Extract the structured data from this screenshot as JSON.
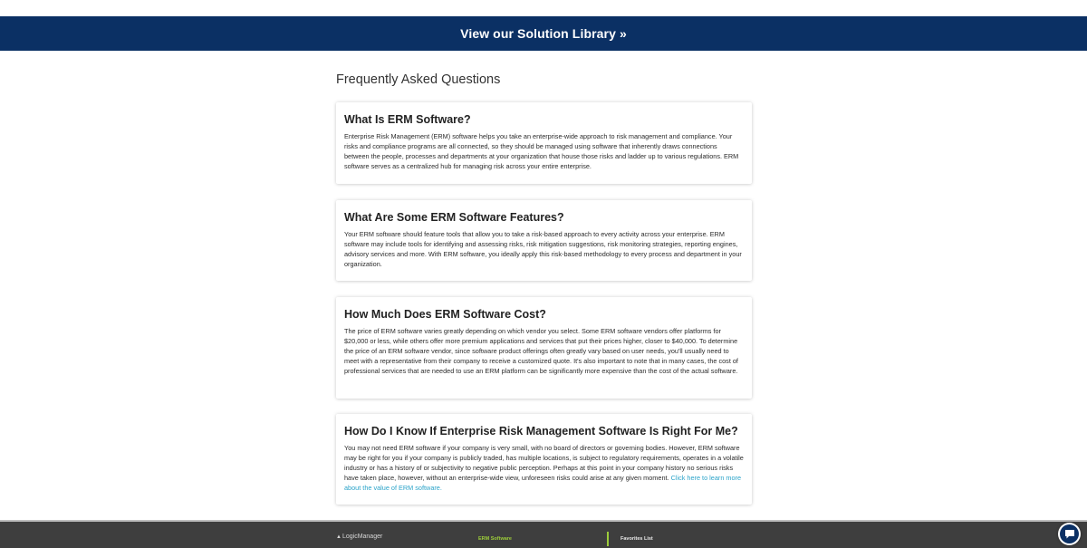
{
  "banner": {
    "link_text": "View our Solution Library »"
  },
  "faq": {
    "title": "Frequently Asked Questions",
    "items": [
      {
        "question": "What Is ERM Software?",
        "answer": "Enterprise Risk Management (ERM) software helps you take an enterprise-wide approach to risk management and compliance. Your risks and compliance programs are all connected, so they should be managed using software that inherently draws connections between the people, processes and departments at your organization that house those risks and ladder up to various regulations. ERM software serves as a centralized hub for managing risk across your entire enterprise."
      },
      {
        "question": "What Are Some ERM Software Features?",
        "answer": "Your ERM software should feature tools that allow you to take a risk-based approach to every activity across your enterprise. ERM software may include tools for identifying and assessing risks, risk mitigation suggestions, risk monitoring strategies, reporting engines, advisory services and more. With ERM software, you ideally apply this risk-based methodology to every process and department in your organization."
      },
      {
        "question": "How Much Does ERM Software Cost?",
        "answer": "The price of ERM software varies greatly depending on which vendor you select. Some ERM software vendors offer platforms for $20,000 or less, while others offer more premium applications and services that put their prices higher, closer to $40,000. To determine the price of an ERM software vendor, since software product offerings often greatly vary based on user needs, you'll usually need to meet with a representative from their company to receive a customized quote. It's also important to note that in many cases, the cost of professional services that are needed to use an ERM platform can be significantly more expensive than the cost of the actual software."
      },
      {
        "question": "How Do I Know If Enterprise Risk Management Software Is Right For Me?",
        "answer": "You may not need ERM software if your company is very small, with no board of directors or governing bodies. However, ERM software may be right for you if your company is publicly traded, has multiple locations, is subject to regulatory requirements, operates in a volatile industry or has a history of or subjectivity to negative public perception. Perhaps at this point in your company history no serious risks have taken place, however, without an enterprise-wide view, unforeseen risks could arise at any given moment.",
        "link_text": "Click here to learn more about the value of ERM software."
      }
    ]
  },
  "footer": {
    "logo_text": "LogicManager",
    "links": [
      "ERM Software",
      "Favorites List"
    ]
  },
  "colors": {
    "banner": "#0b3064",
    "footer": "#3e3e3e",
    "link": "#2aa3c9",
    "footer_accent": "#9ccc3a"
  },
  "icons": {
    "chat": "chat-bubble-icon",
    "logo": "triangle-icon"
  }
}
